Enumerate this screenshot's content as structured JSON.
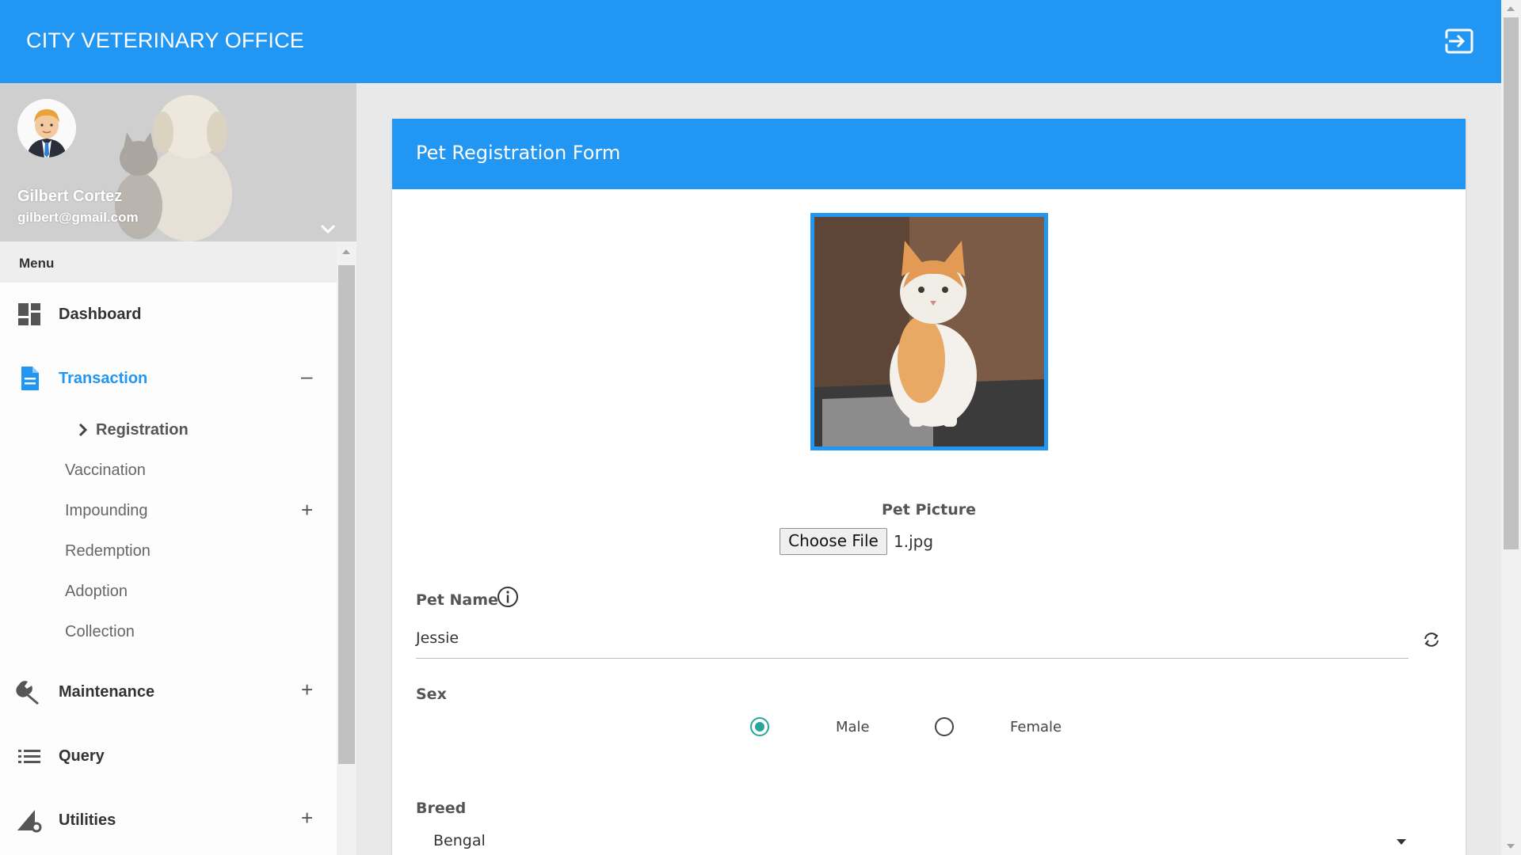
{
  "app": {
    "title": "CITY VETERINARY OFFICE",
    "logout_icon": "logout-icon",
    "brand_color": "#2196f3"
  },
  "user": {
    "name": "Gilbert Cortez",
    "email": "gilbert@gmail.com"
  },
  "sidebar": {
    "menu_header": "Menu",
    "items": [
      {
        "label": "Dashboard",
        "icon": "dashboard-icon"
      },
      {
        "label": "Transaction",
        "icon": "document-icon",
        "toggle": "–",
        "active": true
      },
      {
        "label": "Maintenance",
        "icon": "wrench-icon",
        "toggle": "+"
      },
      {
        "label": "Query",
        "icon": "list-icon"
      },
      {
        "label": "Utilities",
        "icon": "utilities-icon",
        "toggle": "+"
      }
    ],
    "sub_items": [
      {
        "label": "Registration",
        "current": true
      },
      {
        "label": "Vaccination"
      },
      {
        "label": "Impounding",
        "toggle": "+"
      },
      {
        "label": "Redemption"
      },
      {
        "label": "Adoption"
      },
      {
        "label": "Collection"
      }
    ]
  },
  "form": {
    "title": "Pet Registration Form",
    "pet_picture_label": "Pet Picture",
    "choose_file_label": "Choose File",
    "file_name": "1.jpg",
    "pet_name_label": "Pet Name",
    "pet_name_value": "Jessie",
    "sex_label": "Sex",
    "sex_options": [
      "Male",
      "Female"
    ],
    "sex_selected": "Male",
    "breed_label": "Breed",
    "breed_value": "Bengal"
  }
}
